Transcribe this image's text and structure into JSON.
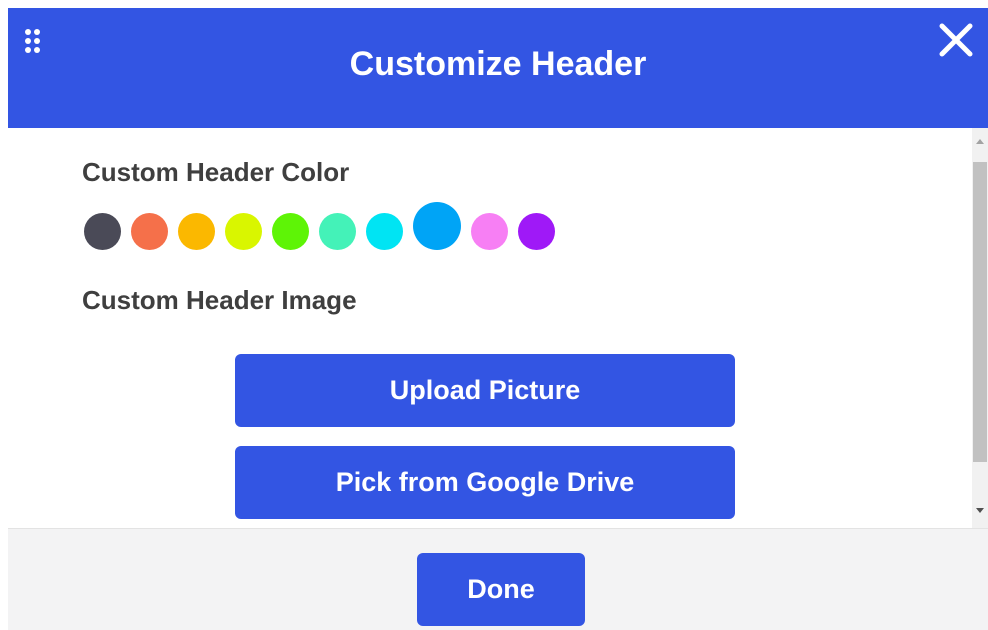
{
  "header": {
    "title": "Customize Header",
    "grip_icon": "drag-grip-icon",
    "close_icon": "close-icon",
    "background_color": "#3355e3"
  },
  "color_section": {
    "label": "Custom Header Color",
    "swatches": [
      {
        "name": "dark-gray",
        "color": "#4a4a57",
        "selected": false
      },
      {
        "name": "orange",
        "color": "#f5704a",
        "selected": false
      },
      {
        "name": "amber",
        "color": "#fbb800",
        "selected": false
      },
      {
        "name": "yellow-green",
        "color": "#d9f600",
        "selected": false
      },
      {
        "name": "green",
        "color": "#5ef406",
        "selected": false
      },
      {
        "name": "mint",
        "color": "#44f2b8",
        "selected": false
      },
      {
        "name": "cyan",
        "color": "#00e4f3",
        "selected": false
      },
      {
        "name": "blue",
        "color": "#00a4f6",
        "selected": true
      },
      {
        "name": "pink",
        "color": "#f77ff4",
        "selected": false
      },
      {
        "name": "purple",
        "color": "#9f19f7",
        "selected": false
      }
    ]
  },
  "image_section": {
    "label": "Custom Header Image",
    "upload_label": "Upload Picture",
    "drive_label": "Pick from Google Drive"
  },
  "footer": {
    "done_label": "Done"
  }
}
